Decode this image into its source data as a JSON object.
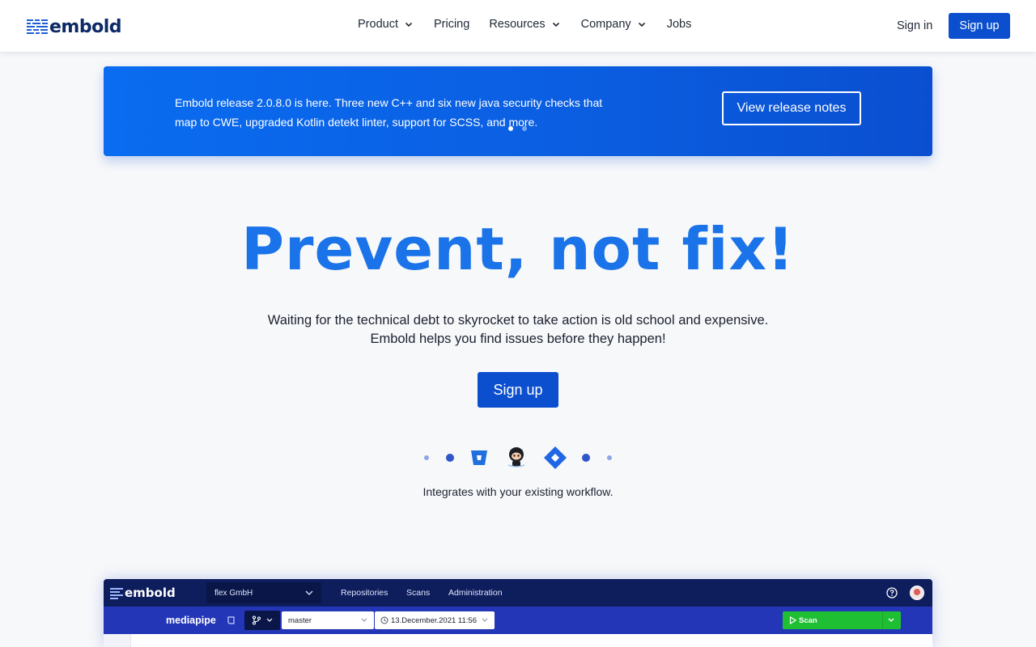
{
  "header": {
    "brand": "embold",
    "nav": [
      {
        "label": "Product",
        "has_dropdown": true
      },
      {
        "label": "Pricing",
        "has_dropdown": false
      },
      {
        "label": "Resources",
        "has_dropdown": true
      },
      {
        "label": "Company",
        "has_dropdown": true
      },
      {
        "label": "Jobs",
        "has_dropdown": false
      }
    ],
    "sign_in": "Sign in",
    "sign_up": "Sign up"
  },
  "banner": {
    "text": "Embold release 2.0.8.0 is here. Three new C++ and six new java security checks that map to CWE, upgraded Kotlin detekt linter, support for SCSS, and more.",
    "button": "View release notes",
    "slides": 2,
    "active_slide": 1
  },
  "hero": {
    "title": "Prevent, not fix!",
    "subtitle_line1": "Waiting for the technical debt to skyrocket to take action is old school and expensive.",
    "subtitle_line2": "Embold helps you find issues before they happen!",
    "cta": "Sign up",
    "integrations_icons": [
      "bitbucket-icon",
      "github-icon",
      "jira-icon"
    ],
    "integrations_text": "Integrates with your existing workflow."
  },
  "app_preview": {
    "brand": "embold",
    "org": "flex GmbH",
    "nav": [
      "Repositories",
      "Scans",
      "Administration"
    ],
    "repo": "mediapipe",
    "branch": "master",
    "date": "13.December.2021 11:56",
    "scan": "Scan"
  },
  "colors": {
    "accent": "#0b4fce",
    "title": "#1a73e8",
    "banner": "#0a6cf0",
    "app_top": "#0e1d5c",
    "app_sub": "#2436b8",
    "scan": "#1fbf33"
  }
}
